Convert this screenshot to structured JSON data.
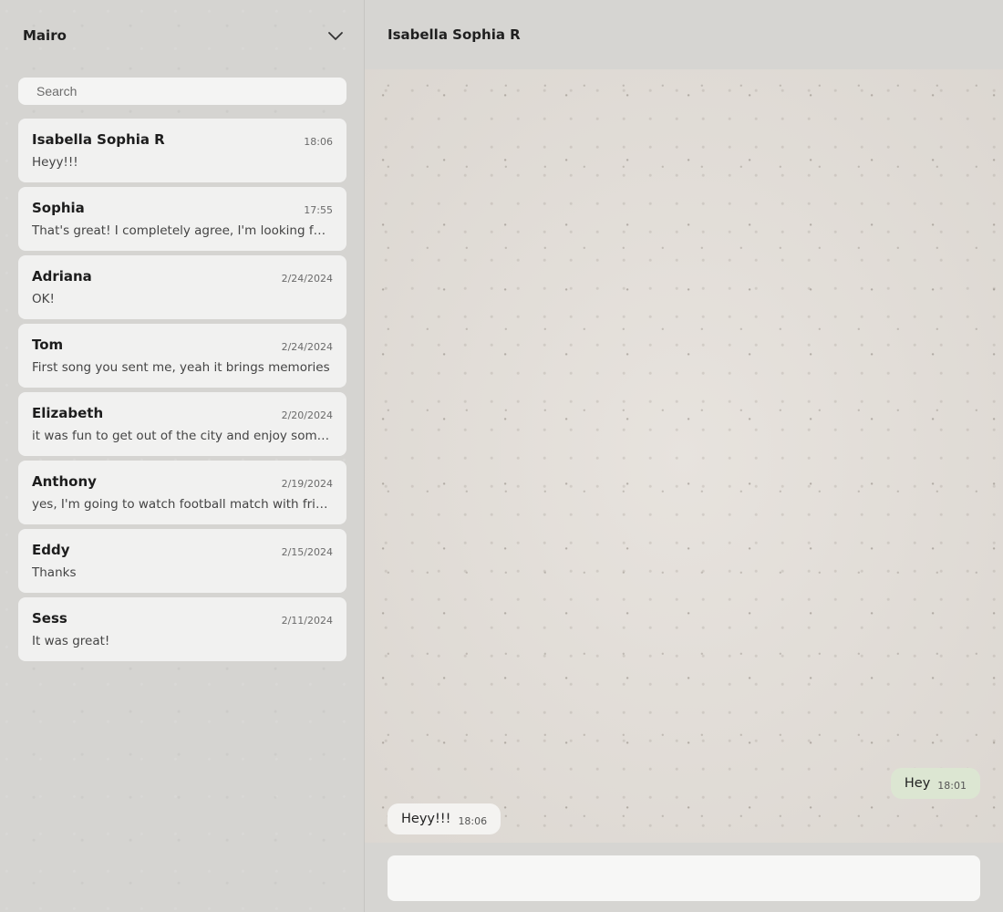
{
  "sidebar": {
    "account_name": "Mairo",
    "search_placeholder": "Search",
    "chats": [
      {
        "name": "Isabella Sophia R",
        "time": "18:06",
        "preview": "Heyy!!!"
      },
      {
        "name": "Sophia",
        "time": "17:55",
        "preview": "That's great! I completely agree, I'm looking for the next trip"
      },
      {
        "name": "Adriana",
        "time": "2/24/2024",
        "preview": "OK!"
      },
      {
        "name": "Tom",
        "time": "2/24/2024",
        "preview": "First song you sent me, yeah it brings memories"
      },
      {
        "name": "Elizabeth",
        "time": "2/20/2024",
        "preview": "it was fun to get out of the city and enjoy some nature"
      },
      {
        "name": "Anthony",
        "time": "2/19/2024",
        "preview": "yes, I'm going to watch football match with friends tonight"
      },
      {
        "name": "Eddy",
        "time": "2/15/2024",
        "preview": "Thanks"
      },
      {
        "name": "Sess",
        "time": "2/11/2024",
        "preview": "It was great!"
      }
    ]
  },
  "conversation": {
    "title": "Isabella Sophia R",
    "messages": [
      {
        "direction": "outgoing",
        "text": "Hey",
        "time": "18:01"
      },
      {
        "direction": "incoming",
        "text": "Heyy!!!",
        "time": "18:06"
      }
    ],
    "composer_value": ""
  },
  "icons": {
    "account_menu": "chevron-down-icon"
  },
  "colors": {
    "outgoing_bubble": "#dce6d2",
    "incoming_bubble": "#f4f3f1",
    "list_item_bg": "#f1f1f0"
  }
}
